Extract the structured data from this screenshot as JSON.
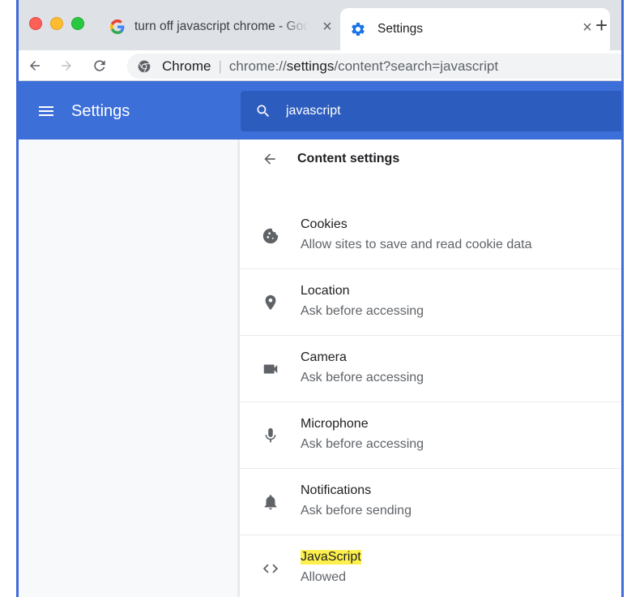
{
  "tabs": [
    {
      "title": "turn off javascript chrome - Google Search",
      "active": false,
      "icon": "google-g-icon"
    },
    {
      "title": "Settings",
      "active": true,
      "icon": "gear-icon"
    }
  ],
  "toolbar": {
    "omnibox_badge": "Chrome",
    "url_scheme": "chrome://",
    "url_host": "settings",
    "url_path": "/content?search=javascript"
  },
  "header": {
    "title": "Settings",
    "search_value": "javascript"
  },
  "content": {
    "title": "Content settings",
    "rows": [
      {
        "label": "Cookies",
        "sub": "Allow sites to save and read cookie data",
        "icon": "cookie-icon"
      },
      {
        "label": "Location",
        "sub": "Ask before accessing",
        "icon": "location-pin-icon"
      },
      {
        "label": "Camera",
        "sub": "Ask before accessing",
        "icon": "camera-icon"
      },
      {
        "label": "Microphone",
        "sub": "Ask before accessing",
        "icon": "microphone-icon"
      },
      {
        "label": "Notifications",
        "sub": "Ask before sending",
        "icon": "bell-icon"
      },
      {
        "label": "JavaScript",
        "sub": "Allowed",
        "icon": "code-brackets-icon",
        "highlighted": true
      }
    ]
  },
  "colors": {
    "header_blue": "#3d6fd9",
    "search_blue": "#2d5cbf",
    "highlight": "#fdf04d"
  }
}
